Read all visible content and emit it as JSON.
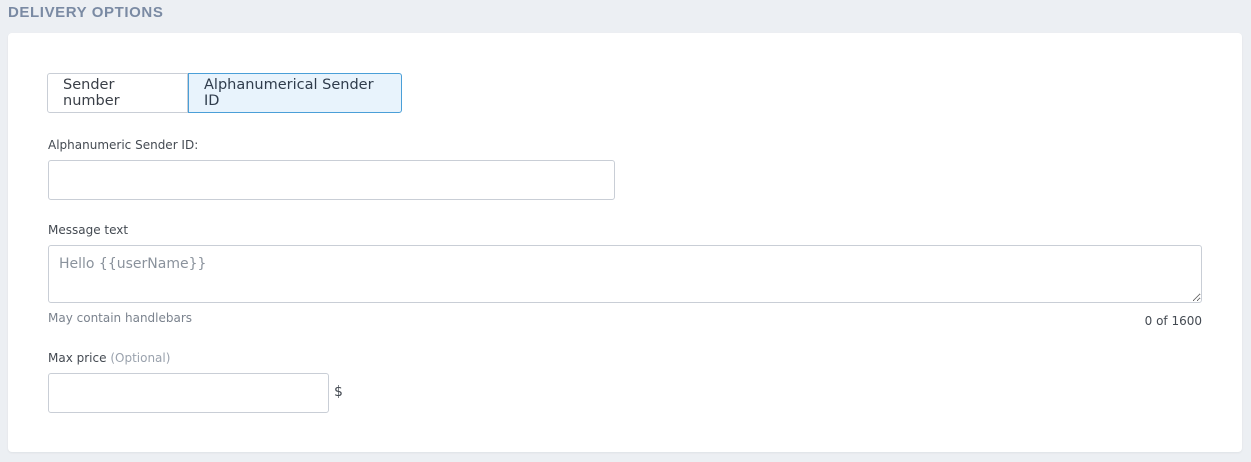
{
  "section": {
    "title": "DELIVERY OPTIONS"
  },
  "sender_toggle": {
    "options": [
      {
        "label": "Sender number",
        "selected": false
      },
      {
        "label": "Alphanumerical Sender ID",
        "selected": true
      }
    ]
  },
  "sender_id": {
    "label": "Alphanumeric Sender ID:",
    "value": "",
    "placeholder": ""
  },
  "message": {
    "label": "Message text",
    "value": "",
    "placeholder": "Hello {{userName}}",
    "hint": "May contain handlebars",
    "counter": "0 of 1600"
  },
  "max_price": {
    "label": "Max price",
    "optional_label": "(Optional)",
    "value": "",
    "currency": "$"
  },
  "colors": {
    "accent": "#4a9fd8",
    "selected_bg": "#e8f3fc",
    "section_title": "#7a8aa3",
    "page_bg": "#eceff3"
  }
}
